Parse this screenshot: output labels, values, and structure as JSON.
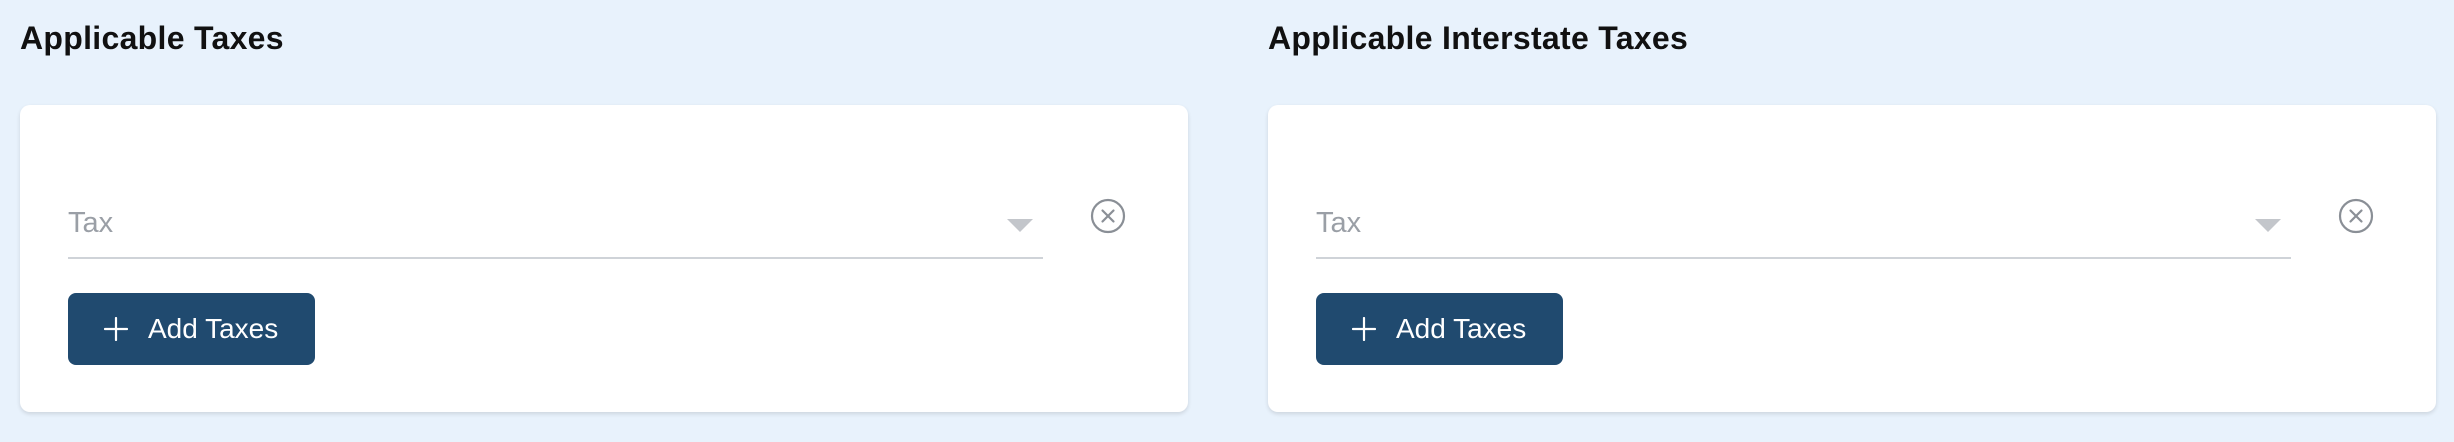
{
  "colors": {
    "page_background": "#e8f2fc",
    "card_background": "#ffffff",
    "button_background": "#204a6f",
    "button_text": "#ffffff",
    "placeholder_text": "#9a9fa6",
    "icon_gray": "#8a8f96"
  },
  "sections": [
    {
      "title": "Applicable Taxes",
      "tax_select": {
        "placeholder": "Tax",
        "value": "",
        "icon": "chevron-down-icon"
      },
      "clear_icon": "close-circle-icon",
      "add_button": {
        "label": "Add Taxes",
        "icon": "plus-icon"
      }
    },
    {
      "title": "Applicable Interstate Taxes",
      "tax_select": {
        "placeholder": "Tax",
        "value": "",
        "icon": "chevron-down-icon"
      },
      "clear_icon": "close-circle-icon",
      "add_button": {
        "label": "Add Taxes",
        "icon": "plus-icon"
      }
    }
  ]
}
